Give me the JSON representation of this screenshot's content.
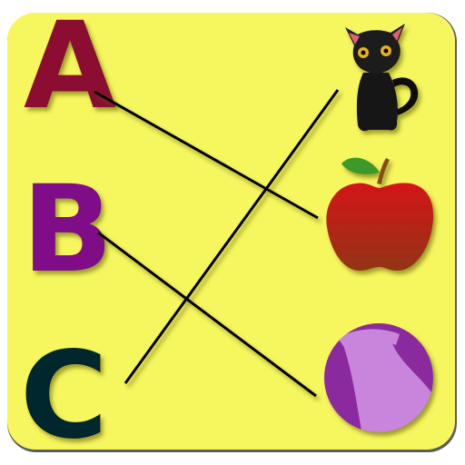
{
  "letters": [
    "A",
    "B",
    "C"
  ],
  "pictures": [
    "cat",
    "apple",
    "ball"
  ],
  "matches": [
    {
      "letter": "A",
      "picture": "apple"
    },
    {
      "letter": "B",
      "picture": "ball"
    },
    {
      "letter": "C",
      "picture": "cat"
    }
  ],
  "colors": {
    "background": "#f6f65e",
    "letter_a": "#8c0a32",
    "letter_b": "#7e0c87",
    "letter_c": "#04282d",
    "line": "#000000"
  }
}
